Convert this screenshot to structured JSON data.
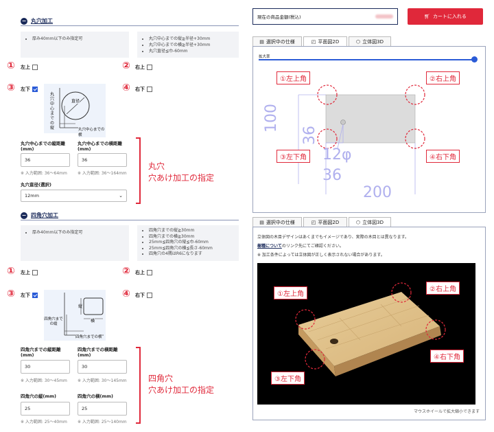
{
  "round": {
    "title": "丸穴加工",
    "note_left": "厚み40mm以下のみ指定可",
    "notes_right": [
      "丸穴中心までの縦≧半径+30mm",
      "丸穴中心までの横≧半径+30mm",
      "丸穴直径≦巾-60mm"
    ],
    "corners": [
      {
        "num": "①",
        "label": "左上",
        "checked": false
      },
      {
        "num": "②",
        "label": "右上",
        "checked": false
      },
      {
        "num": "③",
        "label": "左下",
        "checked": true
      },
      {
        "num": "④",
        "label": "右下",
        "checked": false
      }
    ],
    "diagram": {
      "ylabel": "丸穴中心までの縦",
      "xlabel": "丸穴中心までの横",
      "circle_label": "直径"
    },
    "fields": [
      {
        "label": "丸穴中心までの縦距離 (mm)",
        "value": "36",
        "hint": "※ 入力範囲: 36～64mm"
      },
      {
        "label": "丸穴中心までの横距離 (mm)",
        "value": "36",
        "hint": "※ 入力範囲: 36～164mm"
      }
    ],
    "select_label": "丸穴直径(選択)",
    "select_value": "12mm",
    "callout": [
      "丸穴",
      "穴あけ加工の指定"
    ]
  },
  "square": {
    "title": "四角穴加工",
    "note_left": "厚み40mm以下のみ指定可",
    "notes_right": [
      "四角穴までの縦≧30mm",
      "四角穴までの横≧30mm",
      "25mm≦四角穴の縦≦巾-60mm",
      "25mm≦四角穴の横≦長さ-60mm",
      "四角穴の4隅はR6になります"
    ],
    "corners": [
      {
        "num": "①",
        "label": "左上",
        "checked": false
      },
      {
        "num": "②",
        "label": "右上",
        "checked": false
      },
      {
        "num": "③",
        "label": "左下",
        "checked": true
      },
      {
        "num": "④",
        "label": "右下",
        "checked": false
      }
    ],
    "diagram": {
      "ylabel": "四角穴までの縦",
      "xlabel": "四角穴までの横",
      "h_label": "縦",
      "w_label": "横"
    },
    "fields": [
      {
        "label": "四角穴までの縦距離 (mm)",
        "value": "30",
        "hint": "※ 入力範囲: 30～45mm"
      },
      {
        "label": "四角穴までの横距離 (mm)",
        "value": "30",
        "hint": "※ 入力範囲: 30～145mm"
      },
      {
        "label": "四角穴の縦(mm)",
        "value": "25",
        "hint": "※ 入力範囲: 25～40mm"
      },
      {
        "label": "四角穴の横(mm)",
        "value": "25",
        "hint": "※ 入力範囲: 25～140mm"
      }
    ],
    "callout": [
      "四角穴",
      "穴あけ加工の指定"
    ]
  },
  "price": {
    "label": "現在の商品金額(税込)",
    "cart_button": "カートに入れる"
  },
  "tabs": [
    "選択中の仕様",
    "平面図2D",
    "立体図3D"
  ],
  "plan2d": {
    "zoom_label": "拡大率",
    "zoom_fraction": 1.0,
    "dims": {
      "height": "100",
      "y_offset": "36",
      "x_offset": "36",
      "diameter": "12φ",
      "length": "200"
    },
    "corner_labels": [
      "①左上角",
      "②右上角",
      "③左下角",
      "④右下角"
    ]
  },
  "view3d": {
    "notes": [
      "立体図の木目デザインはあくまでもイメージであり、実際の木目とは異なります。",
      "のリンク先にてご確認ください。",
      "※ 加工条件によっては立体図が正しく表示されない場合があります。"
    ],
    "link_text": "樹種について",
    "corner_labels": [
      "①左上角",
      "②右上角",
      "③左下角",
      "④右下角"
    ],
    "zoom_hint": "マウスホイールで拡大縮小できます"
  },
  "colors": {
    "accent_red": "#e0283a",
    "navy": "#1a2a5a",
    "dimension_purple": "#b0b0ee"
  }
}
